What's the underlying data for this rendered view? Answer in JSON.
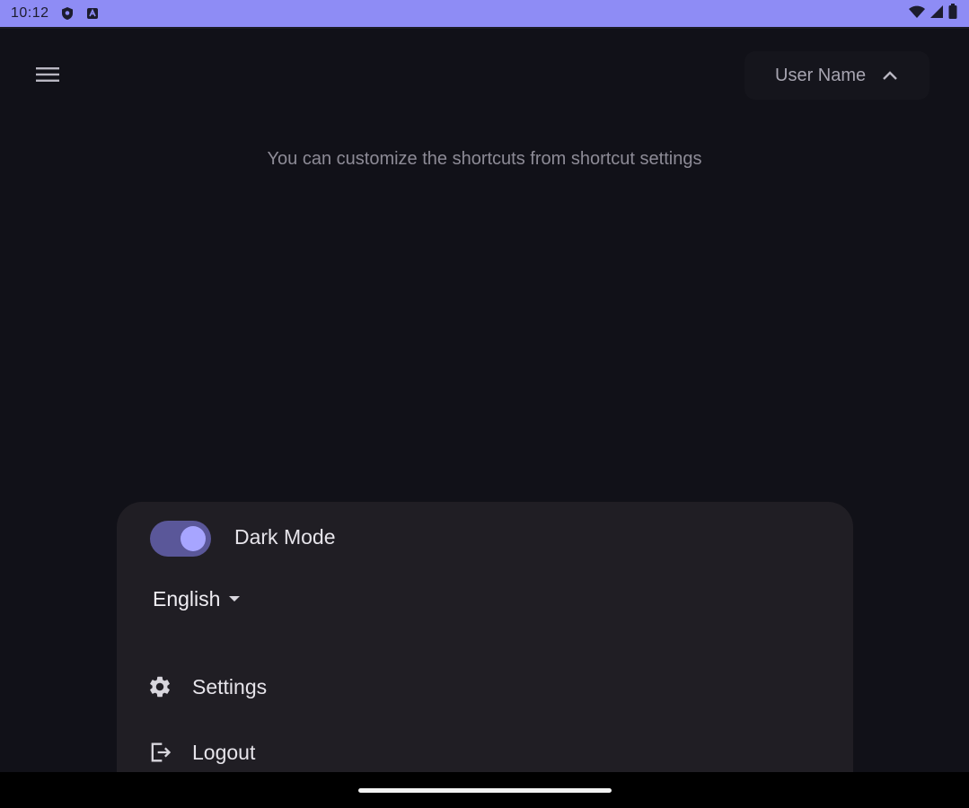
{
  "status_bar": {
    "time": "10:12",
    "left_icons": [
      "shield-icon",
      "app-notification-icon"
    ],
    "right_icons": [
      "wifi-icon",
      "cell-signal-icon",
      "battery-icon"
    ],
    "color": "#8e8cf5"
  },
  "header": {
    "menu_icon": "hamburger-menu-icon",
    "user_name": "User Name",
    "user_chevron": "chevron-up-icon"
  },
  "main": {
    "hint": "You can customize the shortcuts from shortcut settings"
  },
  "user_menu": {
    "dark_mode": {
      "label": "Dark Mode",
      "enabled": true,
      "accent": "#a7a5ff"
    },
    "language": {
      "value": "English"
    },
    "items": [
      {
        "label": "Settings",
        "icon": "gear-icon"
      },
      {
        "label": "Logout",
        "icon": "logout-icon"
      }
    ]
  },
  "theme": {
    "background": "#111118",
    "panel": "#201e24"
  }
}
